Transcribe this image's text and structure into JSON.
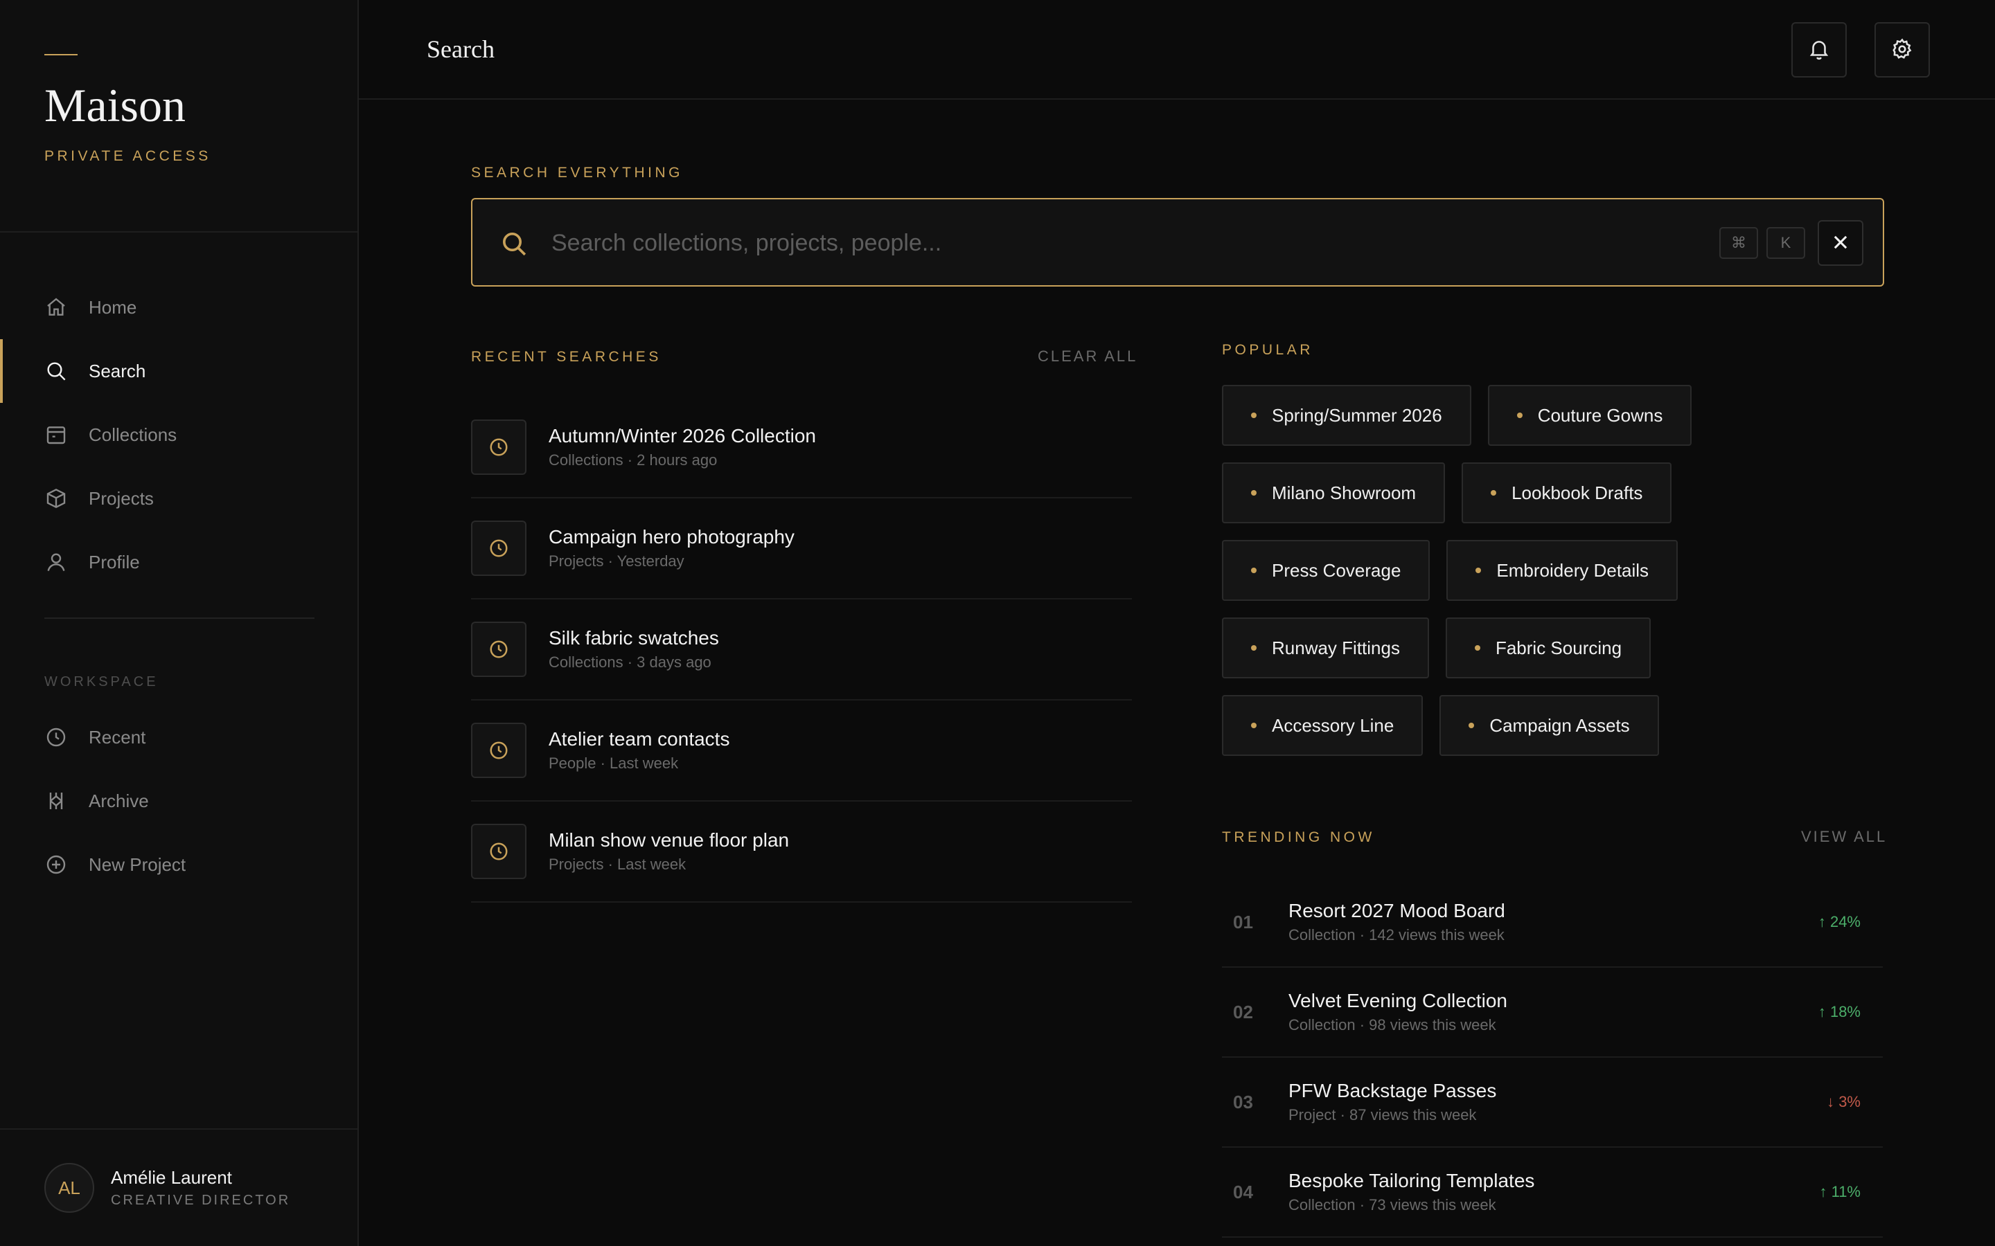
{
  "brand": {
    "name": "Maison",
    "subtitle": "PRIVATE ACCESS"
  },
  "nav": {
    "items": [
      {
        "label": "Home",
        "icon": "home-icon"
      },
      {
        "label": "Search",
        "icon": "search-icon",
        "active": true
      },
      {
        "label": "Collections",
        "icon": "calendar-icon"
      },
      {
        "label": "Projects",
        "icon": "box-icon"
      },
      {
        "label": "Profile",
        "icon": "user-icon"
      }
    ]
  },
  "workspace": {
    "label": "WORKSPACE",
    "items": [
      {
        "label": "Recent",
        "icon": "clock-icon"
      },
      {
        "label": "Archive",
        "icon": "archive-icon"
      },
      {
        "label": "New Project",
        "icon": "plus-circle-icon"
      }
    ]
  },
  "user": {
    "initials": "AL",
    "name": "Amélie Laurent",
    "role": "CREATIVE DIRECTOR"
  },
  "header": {
    "title": "Search"
  },
  "search": {
    "label": "SEARCH EVERYTHING",
    "placeholder": "Search collections, projects, people...",
    "value": "",
    "shortcut_mod": "⌘",
    "shortcut_key": "K"
  },
  "recent": {
    "label": "RECENT SEARCHES",
    "clear_label": "CLEAR ALL",
    "items": [
      {
        "title": "Autumn/Winter 2026 Collection",
        "meta": "Collections · 2 hours ago"
      },
      {
        "title": "Campaign hero photography",
        "meta": "Projects · Yesterday"
      },
      {
        "title": "Silk fabric swatches",
        "meta": "Collections · 3 days ago"
      },
      {
        "title": "Atelier team contacts",
        "meta": "People · Last week"
      },
      {
        "title": "Milan show venue floor plan",
        "meta": "Projects · Last week"
      }
    ]
  },
  "popular": {
    "label": "POPULAR",
    "tags": [
      [
        "Spring/Summer 2026",
        "Couture Gowns"
      ],
      [
        "Milano Showroom",
        "Lookbook Drafts"
      ],
      [
        "Press Coverage",
        "Embroidery Details"
      ],
      [
        "Runway Fittings",
        "Fabric Sourcing"
      ],
      [
        "Accessory Line",
        "Campaign Assets"
      ]
    ]
  },
  "trending": {
    "label": "TRENDING NOW",
    "view_all_label": "VIEW ALL",
    "items": [
      {
        "rank": "01",
        "title": "Resort 2027 Mood Board",
        "meta": "Collection · 142 views this week",
        "change": "↑ 24%",
        "direction": "up"
      },
      {
        "rank": "02",
        "title": "Velvet Evening Collection",
        "meta": "Collection · 98 views this week",
        "change": "↑ 18%",
        "direction": "up"
      },
      {
        "rank": "03",
        "title": "PFW Backstage Passes",
        "meta": "Project · 87 views this week",
        "change": "↓ 3%",
        "direction": "down"
      },
      {
        "rank": "04",
        "title": "Bespoke Tailoring Templates",
        "meta": "Collection · 73 views this week",
        "change": "↑ 11%",
        "direction": "up"
      }
    ]
  },
  "colors": {
    "accent": "#c9a25a",
    "up": "#4caf6a",
    "down": "#c25a4a",
    "background": "#0b0b0b"
  }
}
